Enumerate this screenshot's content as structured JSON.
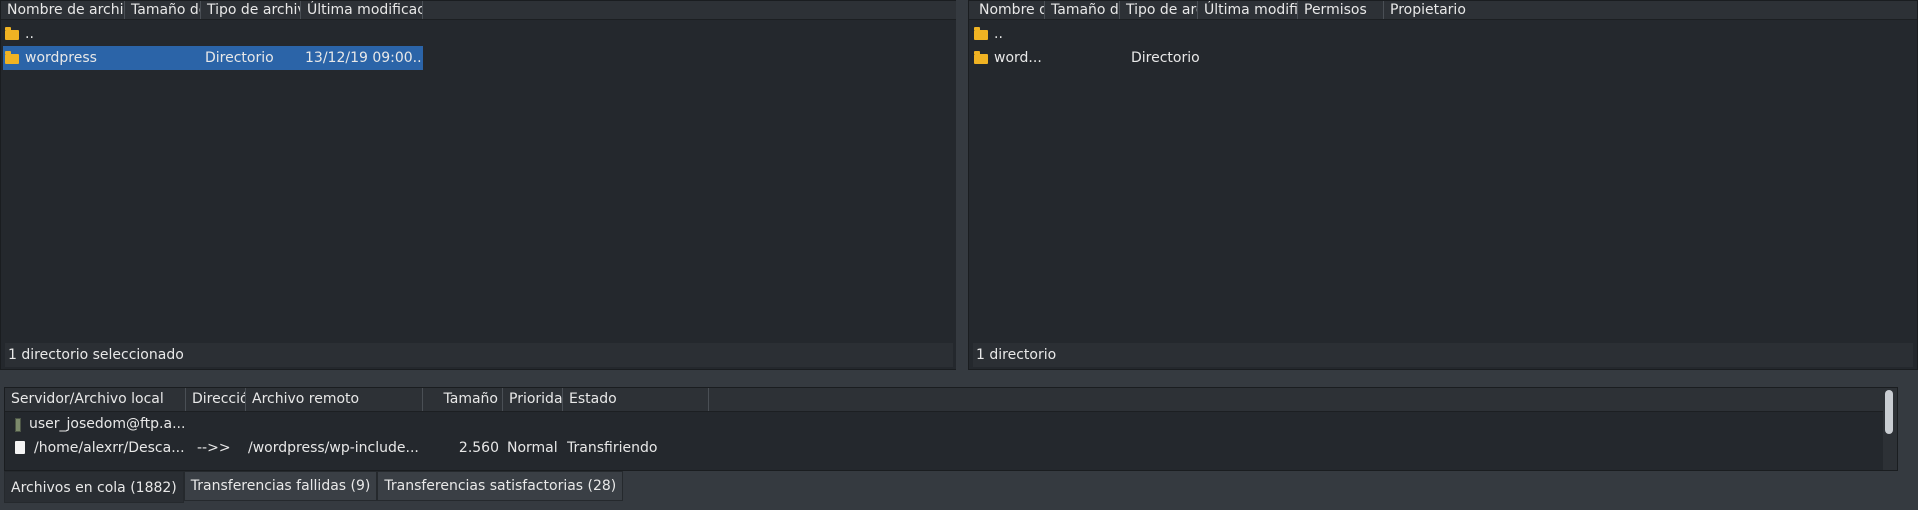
{
  "local": {
    "columns": [
      "Nombre de archivo",
      "Tamaño de archivo",
      "Tipo de archivo",
      "Última modificación"
    ],
    "rows": [
      {
        "name": "..",
        "size": "",
        "type": "",
        "modified": ""
      },
      {
        "name": "wordpress",
        "size": "",
        "type": "Directorio",
        "modified": "13/12/19 09:00..."
      }
    ],
    "status": "1 directorio seleccionado"
  },
  "remote": {
    "columns": [
      "Nombre de archivo",
      "Tamaño de archivo",
      "Tipo de archivo",
      "Última modificación",
      "Permisos",
      "Propietario"
    ],
    "rows": [
      {
        "name": "..",
        "type": ""
      },
      {
        "name": "word...",
        "type": "Directorio"
      }
    ],
    "status": "1 directorio"
  },
  "queue": {
    "columns": [
      "Servidor/Archivo local",
      "Dirección",
      "Archivo remoto",
      "Tamaño",
      "Prioridad",
      "Estado"
    ],
    "server": "user_josedom@ftp.a...",
    "item": {
      "local": "/home/alexrr/Desca...",
      "direction": "-->>",
      "remote": "/wordpress/wp-include...",
      "size": "2.560",
      "priority": "Normal",
      "status": "Transfiriendo"
    }
  },
  "tabs": [
    {
      "label": "Archivos en cola (1882)"
    },
    {
      "label": "Transferencias fallidas (9)"
    },
    {
      "label": "Transferencias satisfactorias (28)"
    }
  ],
  "colors": {
    "selection": "#2b64a8",
    "folder": "#f0b323",
    "panel": "#24282d"
  }
}
